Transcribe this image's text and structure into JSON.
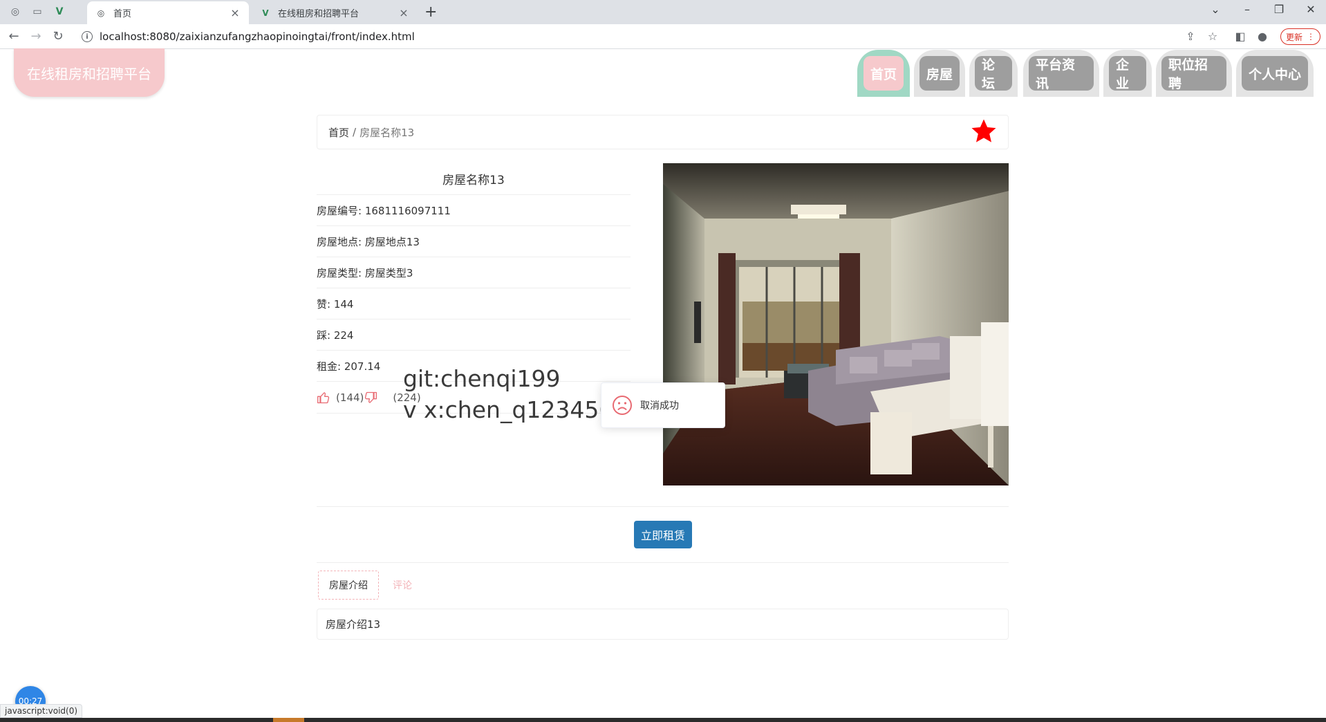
{
  "browser": {
    "tabs": [
      {
        "title": "首页",
        "active": true
      },
      {
        "title": "在线租房和招聘平台",
        "active": false
      }
    ],
    "url": "localhost:8080/zaixianzufangzhaopinoingtai/front/index.html",
    "update_label": "更新"
  },
  "site": {
    "logo_text": "在线租房和招聘平台",
    "nav": [
      {
        "label": "首页",
        "active": true
      },
      {
        "label": "房屋",
        "active": false
      },
      {
        "label": "论坛",
        "active": false
      },
      {
        "label": "平台资讯",
        "active": false
      },
      {
        "label": "企业",
        "active": false
      },
      {
        "label": "职位招聘",
        "active": false
      },
      {
        "label": "个人中心",
        "active": false
      }
    ]
  },
  "breadcrumb": {
    "home": "首页",
    "separator": "/",
    "current": "房屋名称13"
  },
  "house": {
    "title": "房屋名称13",
    "fields": {
      "number": "房屋编号: 1681116097111",
      "location": "房屋地点: 房屋地点13",
      "type": "房屋类型: 房屋类型3",
      "likes": "赞: 144",
      "dislikes": "踩: 224",
      "rent": "租金: 207.14"
    },
    "like_count": "(144)",
    "dislike_count": "(224)",
    "favorite_color": "#ff0000"
  },
  "watermark": {
    "line1": "git:chenqi199",
    "line2": "v x:chen_q123456"
  },
  "toast": {
    "message": "取消成功"
  },
  "actions": {
    "rent_now": "立即租赁"
  },
  "tabs": {
    "intro": "房屋介绍",
    "comments": "评论"
  },
  "intro_text": "房屋介绍13",
  "recorder": {
    "timer": "00:27"
  },
  "status_bar": "javascript:void(0)",
  "colors": {
    "accent_pink": "#f6c9cc",
    "nav_gray": "#9e9e9e",
    "active_mint": "#a0d8c4",
    "button_blue": "#2779b5"
  }
}
